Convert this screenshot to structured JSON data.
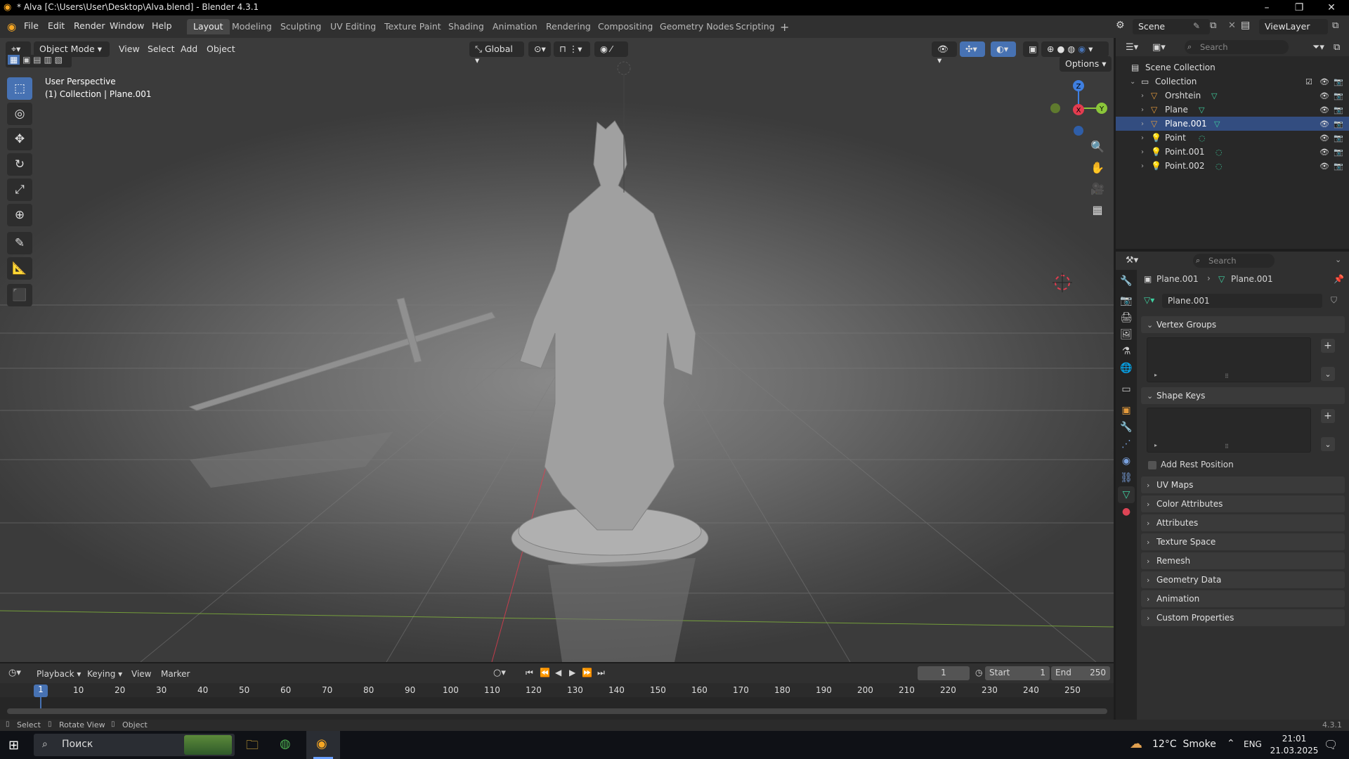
{
  "window": {
    "title": "* Alva [C:\\Users\\User\\Desktop\\Alva.blend] - Blender 4.3.1",
    "controls": [
      "–",
      "❐",
      "✕"
    ]
  },
  "menu": [
    "File",
    "Edit",
    "Render",
    "Window",
    "Help"
  ],
  "workspaces": [
    "Layout",
    "Modeling",
    "Sculpting",
    "UV Editing",
    "Texture Paint",
    "Shading",
    "Animation",
    "Rendering",
    "Compositing",
    "Geometry Nodes",
    "Scripting"
  ],
  "active_workspace": "Layout",
  "scene": {
    "name": "Scene",
    "view_layer": "ViewLayer"
  },
  "viewport": {
    "mode": "Object Mode",
    "menus": [
      "View",
      "Select",
      "Add",
      "Object"
    ],
    "transform_orientation": "Global",
    "options_label": "Options",
    "info_line1": "User Perspective",
    "info_line2": "(1) Collection | Plane.001",
    "gizmo": {
      "z": "Z",
      "y": "Y",
      "x": "X"
    }
  },
  "outliner": {
    "search_placeholder": "Search",
    "root": "Scene Collection",
    "collection": "Collection",
    "items": [
      {
        "name": "Orshtein",
        "selected": false
      },
      {
        "name": "Plane",
        "selected": false
      },
      {
        "name": "Plane.001",
        "selected": true
      },
      {
        "name": "Point",
        "selected": false
      },
      {
        "name": "Point.001",
        "selected": false
      },
      {
        "name": "Point.002",
        "selected": false
      }
    ]
  },
  "properties": {
    "search_placeholder": "Search",
    "breadcrumb_object": "Plane.001",
    "breadcrumb_data": "Plane.001",
    "mesh_name": "Plane.001",
    "panels_open": [
      "Vertex Groups",
      "Shape Keys"
    ],
    "add_rest_position": "Add Rest Position",
    "panels_closed": [
      "UV Maps",
      "Color Attributes",
      "Attributes",
      "Texture Space",
      "Remesh",
      "Geometry Data",
      "Animation",
      "Custom Properties"
    ]
  },
  "timeline": {
    "menus": [
      "Playback",
      "Keying",
      "View",
      "Marker"
    ],
    "current_frame": "1",
    "start_label": "Start",
    "start": "1",
    "end_label": "End",
    "end": "250",
    "ticks": [
      "1",
      "10",
      "20",
      "30",
      "40",
      "50",
      "60",
      "70",
      "80",
      "90",
      "100",
      "110",
      "120",
      "130",
      "140",
      "150",
      "160",
      "170",
      "180",
      "190",
      "200",
      "210",
      "220",
      "230",
      "240",
      "250"
    ]
  },
  "status": {
    "select": "Select",
    "rotate": "Rotate View",
    "object": "Object",
    "version": "4.3.1"
  },
  "taskbar": {
    "search": "Поиск",
    "weather": "12°C  Smoke",
    "lang": "ENG",
    "time": "21:01",
    "date": "21.03.2025"
  },
  "colors": {
    "accent": "#4772b3",
    "selected_row": "#334d80",
    "axis_x": "#e33c4f",
    "axis_y": "#8bc63a",
    "axis_z": "#3f7fe0"
  }
}
